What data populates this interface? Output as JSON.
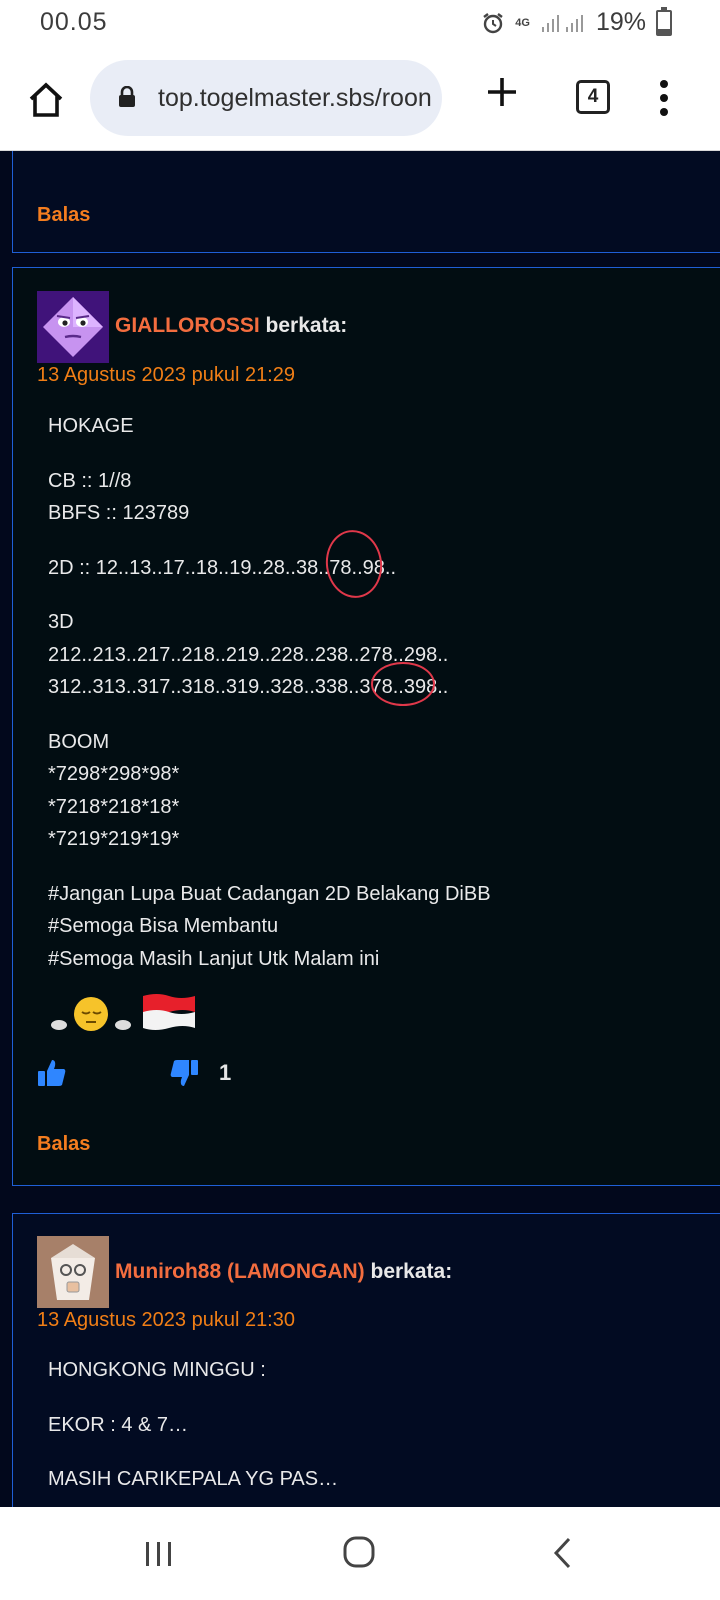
{
  "status_bar": {
    "time": "00.05",
    "network": "4G",
    "battery_percent": "19%",
    "battery_level": 0.19,
    "icons": [
      "alarm-icon",
      "signal-icon",
      "battery-icon"
    ]
  },
  "browser": {
    "url": "top.togelmaster.sbs/roon",
    "tab_count": "4",
    "icons": [
      "home-icon",
      "lock-icon",
      "plus-icon",
      "more-vert-icon"
    ]
  },
  "comments": [
    {
      "reply_label": "Balas"
    },
    {
      "author": "GIALLOROSSI",
      "says": "berkata:",
      "date": "13 Agustus 2023 pukul 21:29",
      "lines": [
        "HOKAGE",
        "CB :: 1//8",
        "BBFS :: 123789",
        "2D :: 12..13..17..18..19..28..38..78..98..",
        "3D",
        "212..213..217..218..219..228..238..278..298..",
        "312..313..317..318..319..328..338..378..398..",
        "BOOM",
        "*7298*298*98*",
        "*7218*218*18*",
        "*7219*219*19*",
        "#Jangan Lupa Buat Cadangan 2D Belakang DiBB",
        "#Semoga Bisa Membantu",
        "#Semoga Masih Lanjut Utk Malam ini"
      ],
      "emoji": [
        "sleeping-face-emoji",
        "indonesia-flag-emoji"
      ],
      "dislike_count": "1",
      "reply_label": "Balas"
    },
    {
      "author": "Muniroh88 (LAMONGAN)",
      "says": "berkata:",
      "date": "13 Agustus 2023 pukul 21:30",
      "lines": [
        "HONGKONG MINGGU :",
        "EKOR : 4 & 7…",
        "MASIH CARIKEPALA YG PAS…"
      ]
    }
  ],
  "colors": {
    "page_bg": "#02081c",
    "card_border": "#1f5fd6",
    "accent_orange": "#f47d1f",
    "author_color": "#f36d3f",
    "vote_blue": "#2f86ff",
    "annotation_red": "#e0384a"
  },
  "nav_bar": {
    "icons": [
      "recents-icon",
      "home-circle-icon",
      "back-icon"
    ]
  }
}
